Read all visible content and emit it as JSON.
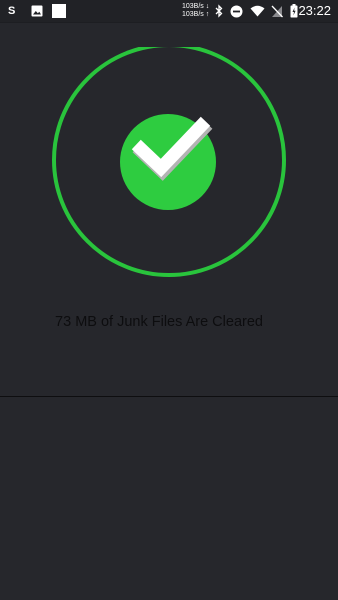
{
  "status_bar": {
    "left_app_label": "S",
    "net_speed_down": "103B/s",
    "net_speed_up": "103B/s",
    "time": "23:22",
    "icons": [
      "gallery-icon",
      "notification-icon",
      "bluetooth-icon",
      "do-not-disturb-icon",
      "wifi-icon",
      "no-sim-icon",
      "battery-icon"
    ]
  },
  "main": {
    "result_message": "73 MB of Junk Files Are Cleared"
  },
  "colors": {
    "background": "#26272c",
    "accent_green": "#2ecc40",
    "ring_green": "#29c43c",
    "text": "#0d0d0f"
  }
}
